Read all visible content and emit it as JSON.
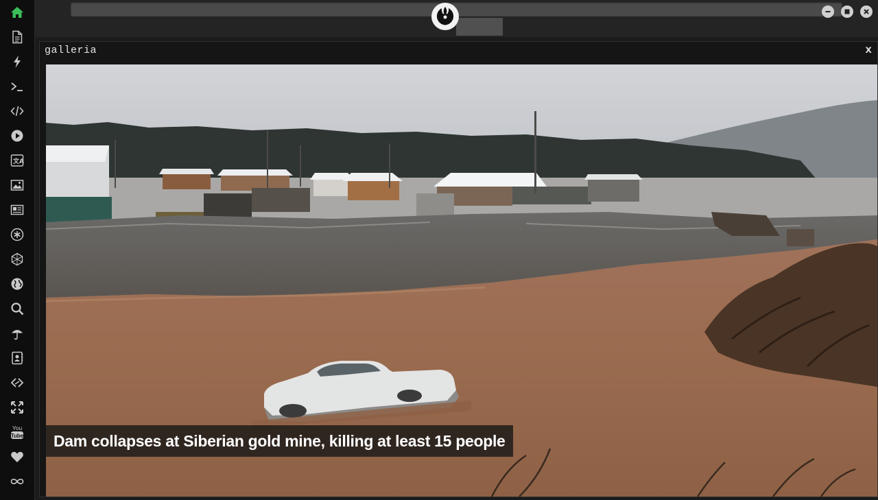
{
  "window": {
    "title": "galleria",
    "close_label": "x"
  },
  "gallery": {
    "caption": "Dam collapses at Siberian gold mine, killing at least 15 people"
  },
  "dock": {
    "items": [
      {
        "name": "home-icon",
        "active": true
      },
      {
        "name": "document-icon"
      },
      {
        "name": "lightning-icon"
      },
      {
        "name": "terminal-icon"
      },
      {
        "name": "code-icon"
      },
      {
        "name": "play-icon"
      },
      {
        "name": "translate-icon"
      },
      {
        "name": "image-icon"
      },
      {
        "name": "news-icon"
      },
      {
        "name": "asterisk-icon"
      },
      {
        "name": "hexagon-icon"
      },
      {
        "name": "globe-icon"
      },
      {
        "name": "search-icon"
      },
      {
        "name": "umbrella-icon"
      },
      {
        "name": "contacts-icon"
      },
      {
        "name": "link-icon"
      },
      {
        "name": "expand-icon"
      },
      {
        "name": "youtube-icon",
        "label": "You Tube"
      },
      {
        "name": "heart-icon"
      },
      {
        "name": "infinity-icon"
      }
    ]
  },
  "colors": {
    "active": "#3bbd5a",
    "icon": "#c9c9c9"
  }
}
